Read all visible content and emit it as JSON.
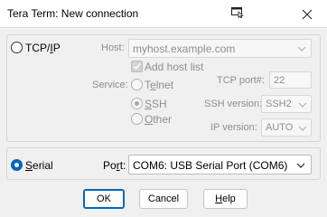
{
  "window": {
    "title": "Tera Term: New connection",
    "icons": {
      "help": "context-help-icon",
      "close": "close-icon"
    }
  },
  "tcpip": {
    "radio_label_pre": "TCP/",
    "radio_label_underline": "I",
    "radio_label_post": "P",
    "host_label": "Host:",
    "host_value": "myhost.example.com",
    "add_host_list_label": "Add host list",
    "service_label": "Service:",
    "services": [
      {
        "pre": "T",
        "u": "e",
        "post": "lnet"
      },
      {
        "pre": "",
        "u": "S",
        "post": "SH"
      },
      {
        "pre": "",
        "u": "O",
        "post": "ther"
      }
    ],
    "tcp_port_label": "TCP port#:",
    "tcp_port_value": "22",
    "ssh_version_label": "SSH version:",
    "ssh_version_value": "SSH2",
    "ip_version_label": "IP version:",
    "ip_version_value": "AUTO"
  },
  "serial": {
    "radio_label_u": "S",
    "radio_label_post": "erial",
    "port_label_pre": "Po",
    "port_label_u": "r",
    "port_label_post": "t:",
    "port_value": "COM6: USB Serial Port (COM6)"
  },
  "buttons": {
    "ok": "OK",
    "cancel": "Cancel",
    "help_u": "H",
    "help_post": "elp"
  },
  "colors": {
    "accent": "#0067c0",
    "disabled_text": "#8e8e8e"
  }
}
